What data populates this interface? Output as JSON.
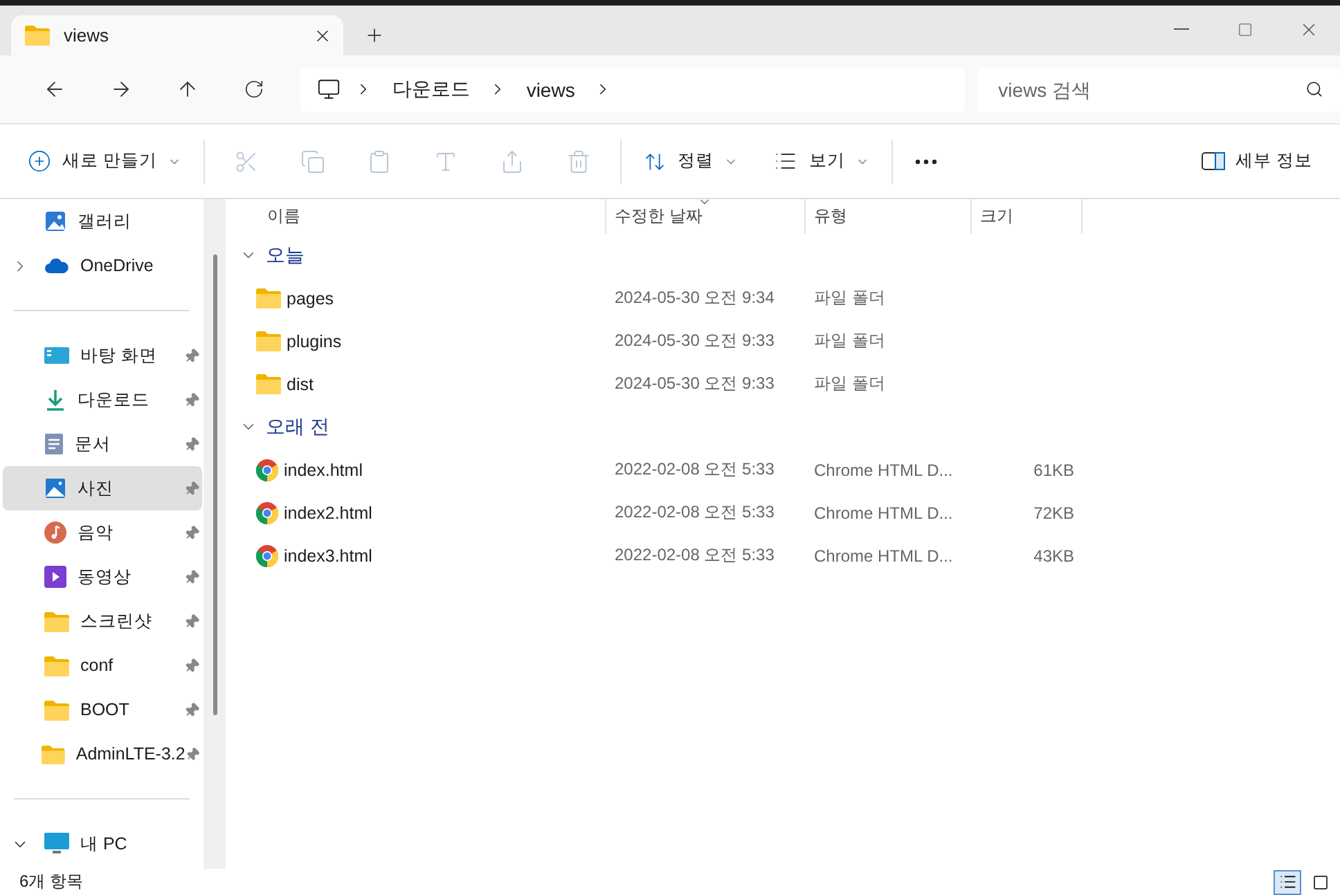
{
  "tab": {
    "title": "views",
    "selected": true
  },
  "address": {
    "crumbs": [
      "다운로드",
      "views"
    ]
  },
  "search": {
    "placeholder": "views 검색"
  },
  "toolbar": {
    "new_label": "새로 만들기",
    "tools": [
      {
        "kind": "cut",
        "disabled": true
      },
      {
        "kind": "copy",
        "disabled": true
      },
      {
        "kind": "paste",
        "disabled": true
      },
      {
        "kind": "rename",
        "disabled": true
      },
      {
        "kind": "share",
        "disabled": true
      },
      {
        "kind": "delete",
        "disabled": true
      }
    ],
    "sort_label": "정렬",
    "view_label": "보기",
    "details_label": "세부 정보"
  },
  "sidebar": {
    "sections": [
      [
        {
          "label": "갤러리",
          "kind": "gallery",
          "selected": false,
          "pinned": false
        },
        {
          "label": "OneDrive",
          "kind": "cloud",
          "selected": false,
          "pinned": false,
          "expanded": false
        }
      ],
      [
        {
          "label": "바탕 화면",
          "kind": "desktop",
          "selected": false,
          "pinned": true
        },
        {
          "label": "다운로드",
          "kind": "download",
          "selected": false,
          "pinned": true
        },
        {
          "label": "문서",
          "kind": "documents",
          "selected": false,
          "pinned": true
        },
        {
          "label": "사진",
          "kind": "pictures",
          "selected": true,
          "pinned": true
        },
        {
          "label": "음악",
          "kind": "music",
          "selected": false,
          "pinned": true
        },
        {
          "label": "동영상",
          "kind": "videos",
          "selected": false,
          "pinned": true
        },
        {
          "label": "스크린샷",
          "kind": "folder",
          "selected": false,
          "pinned": true
        },
        {
          "label": "conf",
          "kind": "folder",
          "selected": false,
          "pinned": true
        },
        {
          "label": "BOOT",
          "kind": "folder",
          "selected": false,
          "pinned": true
        },
        {
          "label": "AdminLTE-3.2",
          "kind": "folder",
          "selected": false,
          "pinned": true
        }
      ],
      [
        {
          "label": "내 PC",
          "kind": "pc",
          "selected": false,
          "pinned": false,
          "expanded": true
        }
      ]
    ]
  },
  "table": {
    "columns": [
      {
        "label": "이름",
        "sorted": false
      },
      {
        "label": "수정한 날짜",
        "sorted": true
      },
      {
        "label": "유형",
        "sorted": false
      },
      {
        "label": "크기",
        "sorted": false
      }
    ],
    "groups": [
      {
        "label": "오늘",
        "expanded": true,
        "rows": [
          {
            "name": "pages",
            "kind": "folder",
            "date": "2024-05-30 오전 9:34",
            "type": "파일 폴더"
          },
          {
            "name": "plugins",
            "kind": "folder",
            "date": "2024-05-30 오전 9:33",
            "type": "파일 폴더"
          },
          {
            "name": "dist",
            "kind": "folder",
            "date": "2024-05-30 오전 9:33",
            "type": "파일 폴더"
          }
        ]
      },
      {
        "label": "오래 전",
        "expanded": true,
        "rows": [
          {
            "name": "index.html",
            "kind": "html",
            "date": "2022-02-08 오전 5:33",
            "type": "Chrome HTML D...",
            "size": "61KB"
          },
          {
            "name": "index2.html",
            "kind": "html",
            "date": "2022-02-08 오전 5:33",
            "type": "Chrome HTML D...",
            "size": "72KB"
          },
          {
            "name": "index3.html",
            "kind": "html",
            "date": "2022-02-08 오전 5:33",
            "type": "Chrome HTML D...",
            "size": "43KB"
          }
        ]
      }
    ]
  },
  "status_bar": {
    "count": "6개 항목",
    "views": [
      {
        "kind": "details",
        "selected": true
      },
      {
        "kind": "tiles",
        "selected": false
      }
    ]
  }
}
